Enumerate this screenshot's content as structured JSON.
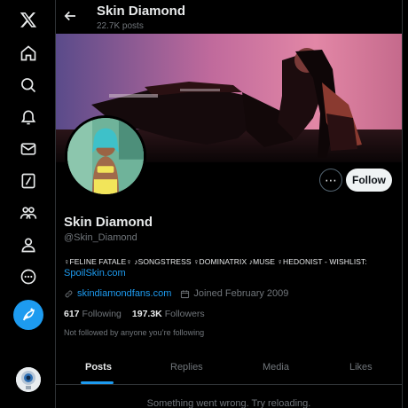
{
  "nav": {
    "items": [
      "x-logo-icon",
      "home-icon",
      "search-icon",
      "notifications-icon",
      "messages-icon",
      "grok-icon",
      "communities-icon",
      "profile-icon",
      "more-icon"
    ],
    "compose": "feather-icon"
  },
  "header": {
    "title": "Skin Diamond",
    "subtitle": "22.7K posts"
  },
  "profile": {
    "name": "Skin Diamond",
    "handle": "@Skin_Diamond",
    "bio": "♀FELINE FATALE♀ ♪SONGSTRESS ♀DOMINATRIX ♪MUSE ♀HEDONIST - WISHLIST:",
    "bio_link": "SpoilSkin.com",
    "website": "skindiamondfans.com",
    "joined": "Joined February 2009",
    "following_count": "617",
    "following_label": "Following",
    "followers_count": "197.3K",
    "followers_label": "Followers",
    "not_followed": "Not followed by anyone you’re following"
  },
  "actions": {
    "more": "⋯",
    "follow": "Follow"
  },
  "tabs": [
    "Posts",
    "Replies",
    "Media",
    "Likes"
  ],
  "feed": {
    "error": "Something went wrong. Try reloading."
  },
  "colors": {
    "accent": "#1d9bf0",
    "background": "#000000",
    "text": "#e7e9ea",
    "muted": "#71767b"
  }
}
